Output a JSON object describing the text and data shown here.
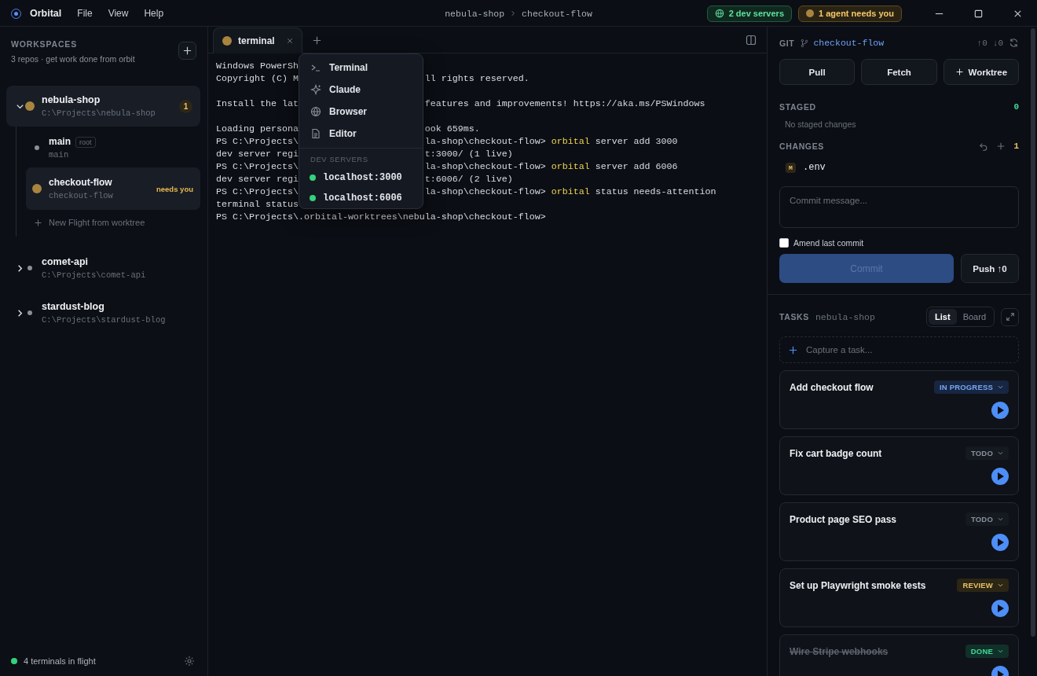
{
  "app": {
    "name": "Orbital",
    "menu": [
      "File",
      "View",
      "Help"
    ]
  },
  "breadcrumb": [
    "nebula-shop",
    "checkout-flow"
  ],
  "status_pills": [
    {
      "kind": "servers",
      "label": "2 dev servers"
    },
    {
      "kind": "agents",
      "label": "1 agent needs you"
    }
  ],
  "sidebar": {
    "title": "WORKSPACES",
    "subtitle": "3 repos · get work done from orbit",
    "workspaces": [
      {
        "name": "nebula-shop",
        "path": "C:\\Projects\\nebula-shop",
        "expanded": true,
        "selected": true,
        "attention": true,
        "badge": "1",
        "children": [
          {
            "name": "main",
            "tag": "root",
            "branch": "main",
            "selected": false,
            "attention": false
          },
          {
            "name": "checkout-flow",
            "branch": "checkout-flow",
            "status": "needs you",
            "selected": true,
            "attention": true
          }
        ],
        "action": "New Flight from worktree"
      },
      {
        "name": "comet-api",
        "path": "C:\\Projects\\comet-api",
        "expanded": false,
        "selected": false,
        "attention": false
      },
      {
        "name": "stardust-blog",
        "path": "C:\\Projects\\stardust-blog",
        "expanded": false,
        "selected": false,
        "attention": false
      }
    ],
    "footer": "4 terminals in flight"
  },
  "terminal": {
    "tab": {
      "label": "terminal",
      "attention": true
    },
    "lines": [
      {
        "kind": "text",
        "left": "Windows PowerSh"
      },
      {
        "kind": "text",
        "left": "Copyright (C) M",
        "right": "ll rights reserved."
      },
      {
        "kind": "blank"
      },
      {
        "kind": "text",
        "left": "Install the lat",
        "right": "features and improvements! https://aka.ms/PSWindows"
      },
      {
        "kind": "blank"
      },
      {
        "kind": "text",
        "left": "Loading persona",
        "right": "ook 659ms."
      },
      {
        "kind": "text",
        "left": "PS C:\\Projects\\",
        "right": "la-shop\\checkout-flow>",
        "command": "orbital",
        "args": "server add 3000"
      },
      {
        "kind": "text",
        "left": "dev server regi",
        "right": "t:3000/ (1 live)"
      },
      {
        "kind": "text",
        "left": "PS C:\\Projects\\",
        "right": "la-shop\\checkout-flow>",
        "command": "orbital",
        "args": "server add 6006"
      },
      {
        "kind": "text",
        "left": "dev server regi",
        "right": "t:6006/ (2 live)"
      },
      {
        "kind": "text",
        "left": "PS C:\\Projects\\",
        "right": "la-shop\\checkout-flow>",
        "command": "orbital",
        "args": "status needs-attention"
      },
      {
        "kind": "text",
        "left": "terminal status"
      },
      {
        "kind": "text",
        "left": "PS C:\\Projects\\.orbital-worktrees\\nebula-shop\\checkout-flow>"
      }
    ],
    "menu": {
      "items": [
        {
          "kind": "terminal",
          "label": "Terminal"
        },
        {
          "kind": "claude",
          "label": "Claude"
        },
        {
          "kind": "browser",
          "label": "Browser"
        },
        {
          "kind": "editor",
          "label": "Editor"
        }
      ],
      "section": "DEV SERVERS",
      "servers": [
        "localhost:3000",
        "localhost:6006"
      ]
    }
  },
  "git": {
    "title": "GIT",
    "branch": "checkout-flow",
    "ahead": "↑0",
    "behind": "↓0",
    "buttons": [
      {
        "kind": "pull",
        "label": "Pull"
      },
      {
        "kind": "fetch",
        "label": "Fetch"
      },
      {
        "kind": "worktree",
        "label": "Worktree"
      }
    ],
    "staged": {
      "title": "STAGED",
      "count": "0",
      "empty": "No staged changes"
    },
    "changes": {
      "title": "CHANGES",
      "count": "1",
      "files": [
        {
          "status": "M",
          "name": ".env"
        }
      ]
    },
    "commit": {
      "placeholder": "Commit message...",
      "amend": {
        "label": "Amend last commit",
        "checked": false
      },
      "button": {
        "label": "Commit",
        "disabled": true
      },
      "push": "Push ↑0"
    }
  },
  "tasks": {
    "title": "TASKS",
    "repo": "nebula-shop",
    "views": [
      {
        "label": "List",
        "selected": true
      },
      {
        "label": "Board",
        "selected": false
      }
    ],
    "placeholder": "Capture a task...",
    "items": [
      {
        "title": "Add checkout flow",
        "status": "IN PROGRESS",
        "kind": "in_progress",
        "done": false
      },
      {
        "title": "Fix cart badge count",
        "status": "TODO",
        "kind": "todo",
        "done": false
      },
      {
        "title": "Product page SEO pass",
        "status": "TODO",
        "kind": "todo",
        "done": false
      },
      {
        "title": "Set up Playwright smoke tests",
        "status": "REVIEW",
        "kind": "review",
        "done": false
      },
      {
        "title": "Wire Stripe webhooks",
        "status": "DONE",
        "kind": "done",
        "done": true
      }
    ]
  }
}
